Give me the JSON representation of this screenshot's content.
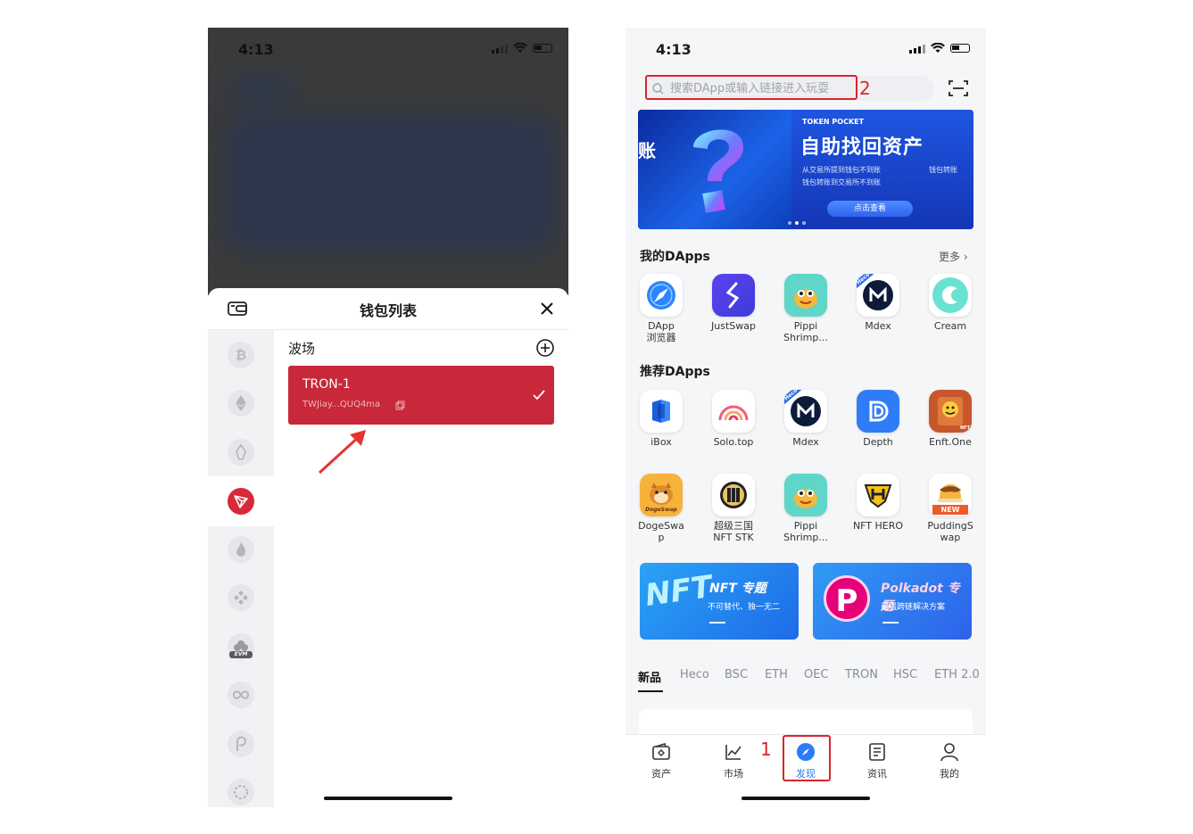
{
  "left_phone": {
    "status_time": "4:13",
    "sheet_title": "钱包列表",
    "chain_group_title": "波场",
    "wallet": {
      "name": "TRON-1",
      "address": "TWJiay...QUQ4ma"
    },
    "chains": [
      "bitcoin-icon",
      "ethereum-icon",
      "eos-icon",
      "tron-icon",
      "huobi-eco-icon",
      "binance-icon",
      "evm-icon",
      "iost-icon",
      "polkadot-icon",
      "kusama-icon"
    ],
    "chain_badge_evm": "EVM",
    "accent": "#c8283a"
  },
  "right_phone": {
    "status_time": "4:13",
    "search": {
      "placeholder": "搜索DApp或输入链接进入玩耍"
    },
    "annotations": {
      "search_num": "2",
      "nav_num": "1"
    },
    "banner": {
      "left_text": "账",
      "brand": "TOKEN POCKET",
      "headline": "自助找回资产",
      "bullet_1": "从交易所提到钱包不到账",
      "bullet_2": "钱包转账到交易所不到账",
      "bullet_3": "钱包转账",
      "cta": "点击查看"
    },
    "my_dapps": {
      "title": "我的DApps",
      "more": "更多",
      "items": [
        {
          "label_1": "DApp",
          "label_2": "浏览器"
        },
        {
          "label_1": "JustSwap",
          "label_2": ""
        },
        {
          "label_1": "Pippi",
          "label_2": "Shrimp..."
        },
        {
          "label_1": "Mdex",
          "label_2": ""
        },
        {
          "label_1": "Cream",
          "label_2": ""
        }
      ]
    },
    "recommended": {
      "title": "推荐DApps",
      "row1": [
        {
          "label_1": "iBox",
          "label_2": ""
        },
        {
          "label_1": "Solo.top",
          "label_2": ""
        },
        {
          "label_1": "Mdex",
          "label_2": ""
        },
        {
          "label_1": "Depth",
          "label_2": ""
        },
        {
          "label_1": "Enft.One",
          "label_2": ""
        }
      ],
      "row2": [
        {
          "label_1": "DogeSwa",
          "label_2": "p"
        },
        {
          "label_1": "超级三国",
          "label_2": "NFT STK"
        },
        {
          "label_1": "Pippi",
          "label_2": "Shrimp..."
        },
        {
          "label_1": "NFT HERO",
          "label_2": ""
        },
        {
          "label_1": "PuddingS",
          "label_2": "wap"
        }
      ],
      "icon_texts": {
        "heco": "Heco",
        "dogeswap": "DogeSwap",
        "new_badge": "NEW",
        "nft": "NFT"
      }
    },
    "promos": [
      {
        "title": "NFT 专题",
        "subtitle": "不可替代、独一无二",
        "art": "NFT"
      },
      {
        "title": "Polkadot 专题",
        "subtitle": "最强跨链解决方案",
        "art": "P"
      }
    ],
    "tabs": [
      "新品",
      "Heco",
      "BSC",
      "ETH",
      "OEC",
      "TRON",
      "HSC",
      "ETH 2.0"
    ],
    "bottom_nav": [
      "资产",
      "市场",
      "发现",
      "资讯",
      "我的"
    ]
  }
}
